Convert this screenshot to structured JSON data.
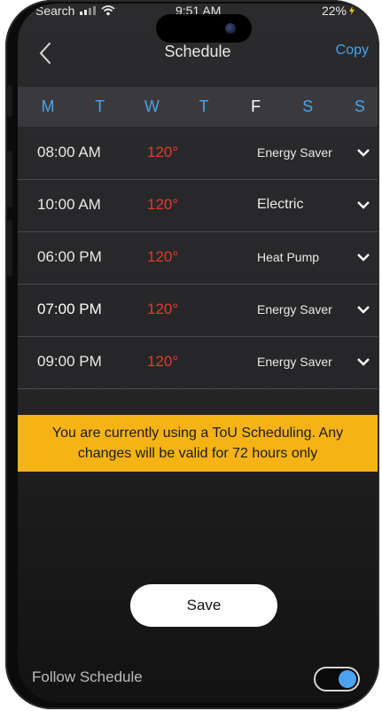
{
  "status_bar": {
    "carrier": "Search",
    "time": "9:51 AM",
    "battery": "22%"
  },
  "nav": {
    "title": "Schedule",
    "copy_label": "Copy"
  },
  "days": [
    {
      "label": "M",
      "active": true
    },
    {
      "label": "T",
      "active": true
    },
    {
      "label": "W",
      "active": true
    },
    {
      "label": "T",
      "active": true
    },
    {
      "label": "F",
      "active": false
    },
    {
      "label": "S",
      "active": true
    },
    {
      "label": "S",
      "active": true
    }
  ],
  "schedule": [
    {
      "time": "08:00 AM",
      "temp": "120°",
      "mode": "Energy Saver"
    },
    {
      "time": "10:00 AM",
      "temp": "120°",
      "mode": "Electric"
    },
    {
      "time": "06:00 PM",
      "temp": "120°",
      "mode": "Heat Pump"
    },
    {
      "time": "07:00 PM",
      "temp": "120°",
      "mode": "Energy Saver"
    },
    {
      "time": "09:00 PM",
      "temp": "120°",
      "mode": "Energy Saver"
    }
  ],
  "banner": {
    "line1": "You are currently using a ToU Scheduling.  Any",
    "line2": "changes will be valid for 72 hours only"
  },
  "save_label": "Save",
  "follow_schedule": {
    "label": "Follow Schedule",
    "on": true
  },
  "colors": {
    "accent": "#4aa3e8",
    "temperature": "#e23b2c",
    "banner": "#f6b315",
    "inactive_day": "#ffffff"
  }
}
